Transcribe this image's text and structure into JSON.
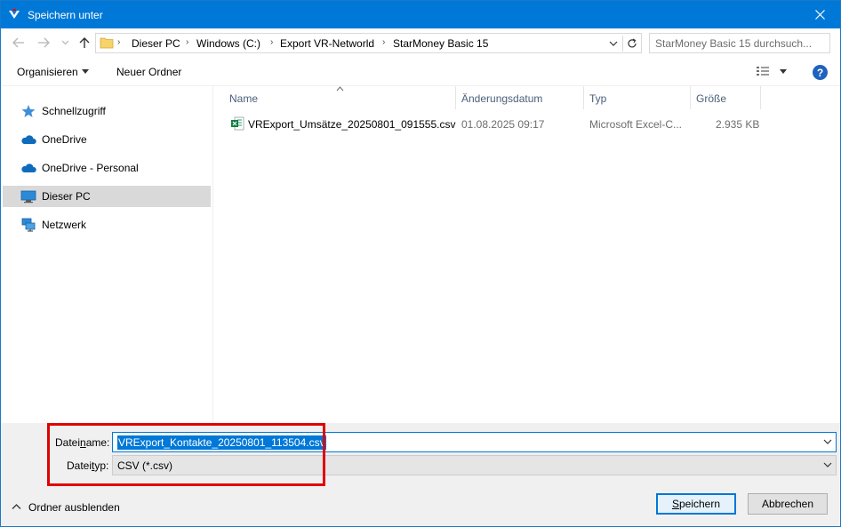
{
  "window": {
    "title": "Speichern unter",
    "accent_color": "#0078d7"
  },
  "nav": {
    "back_icon": "arrow-left-icon",
    "forward_icon": "arrow-right-icon",
    "recent_icon": "chevron-down-icon",
    "up_icon": "arrow-up-icon",
    "breadcrumbs": [
      "Dieser PC",
      "Windows (C:)",
      "Export VR-Networld",
      "StarMoney Basic 15"
    ],
    "search_placeholder": "StarMoney Basic 15 durchsuch..."
  },
  "toolbar": {
    "organize_label": "Organisieren",
    "new_folder_label": "Neuer Ordner",
    "help_label": "?"
  },
  "sidebar": {
    "items": [
      {
        "label": "Schnellzugriff",
        "icon": "star-icon"
      },
      {
        "label": "OneDrive",
        "icon": "cloud-icon"
      },
      {
        "label": "OneDrive - Personal",
        "icon": "cloud-icon"
      },
      {
        "label": "Dieser PC",
        "icon": "computer-icon",
        "selected": true
      },
      {
        "label": "Netzwerk",
        "icon": "network-icon"
      }
    ]
  },
  "files": {
    "columns": [
      "Name",
      "Änderungsdatum",
      "Typ",
      "Größe"
    ],
    "rows": [
      {
        "name": "VRExport_Umsätze_20250801_091555.csv",
        "date": "01.08.2025 09:17",
        "type": "Microsoft Excel-C...",
        "size": "2.935 KB",
        "icon": "excel-csv-icon"
      }
    ]
  },
  "form": {
    "filename_label_pre": "Datei",
    "filename_label_ul": "n",
    "filename_label_post": "ame:",
    "filename_value": "VRExport_Kontakte_20250801_113504.csv",
    "filetype_label_pre": "Datei",
    "filetype_label_ul": "t",
    "filetype_label_post": "yp:",
    "filetype_value": "CSV (*.csv)",
    "highlight_color": "#e00000"
  },
  "footer": {
    "hide_folders_label": "Ordner ausblenden",
    "save_label_ul": "S",
    "save_label_rest": "peichern",
    "cancel_label": "Abbrechen"
  }
}
